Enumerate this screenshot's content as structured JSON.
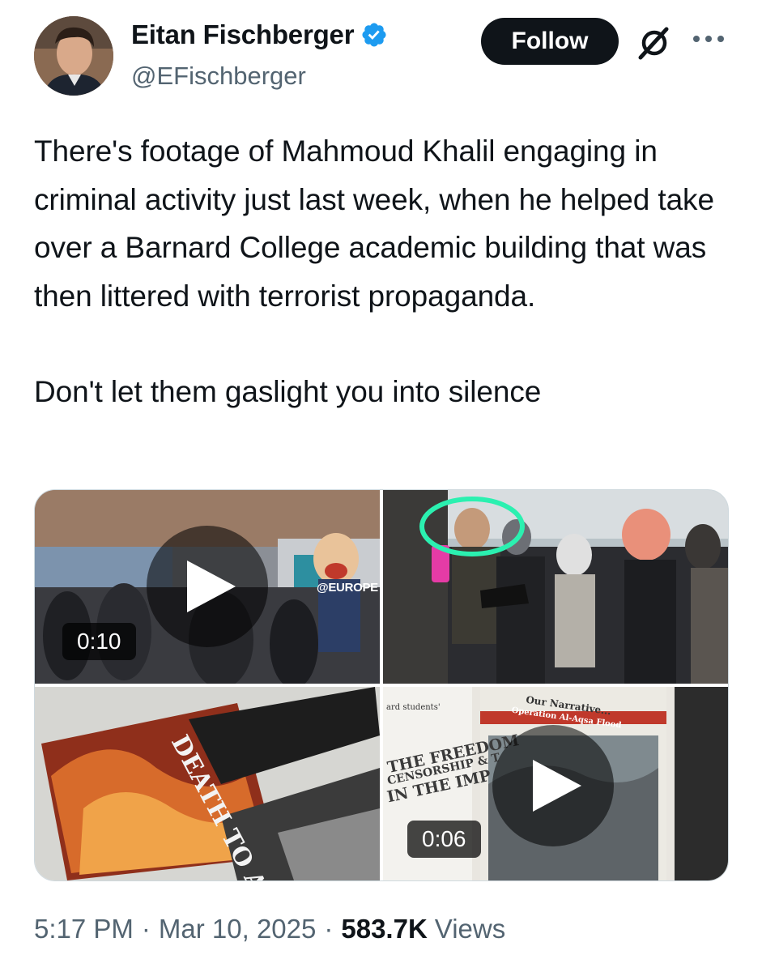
{
  "author": {
    "name": "Eitan Fischberger",
    "handle": "@EFischberger",
    "verified": true,
    "verified_color": "#1d9bf0"
  },
  "actions": {
    "follow_label": "Follow",
    "grok_icon": "grok-icon",
    "more_icon": "more-options-icon"
  },
  "tweet": {
    "paragraph_1": "There's footage of Mahmoud Khalil engaging in criminal activity just last week, when he helped take over a Barnard College academic building that was then littered with terrorist propaganda.",
    "paragraph_2": "Don't let them gaslight you into silence"
  },
  "media": [
    {
      "kind": "video",
      "duration": "0:10",
      "overlay_text": "@EUROPE"
    },
    {
      "kind": "image",
      "highlight_color": "#2bf0b0"
    },
    {
      "kind": "image",
      "overlay_text": "DEATH TO A"
    },
    {
      "kind": "video",
      "duration": "0:06",
      "overlay_text": [
        "ard students'",
        "THE FREEDOM",
        "CENSORSHIP & T",
        "IN THE IMP",
        "Our Narrative...",
        "Operation Al-Aqsa Flood"
      ]
    }
  ],
  "meta": {
    "time": "5:17 PM",
    "separator": "·",
    "date": "Mar 10, 2025",
    "views_count": "583.7K",
    "views_label": "Views"
  }
}
